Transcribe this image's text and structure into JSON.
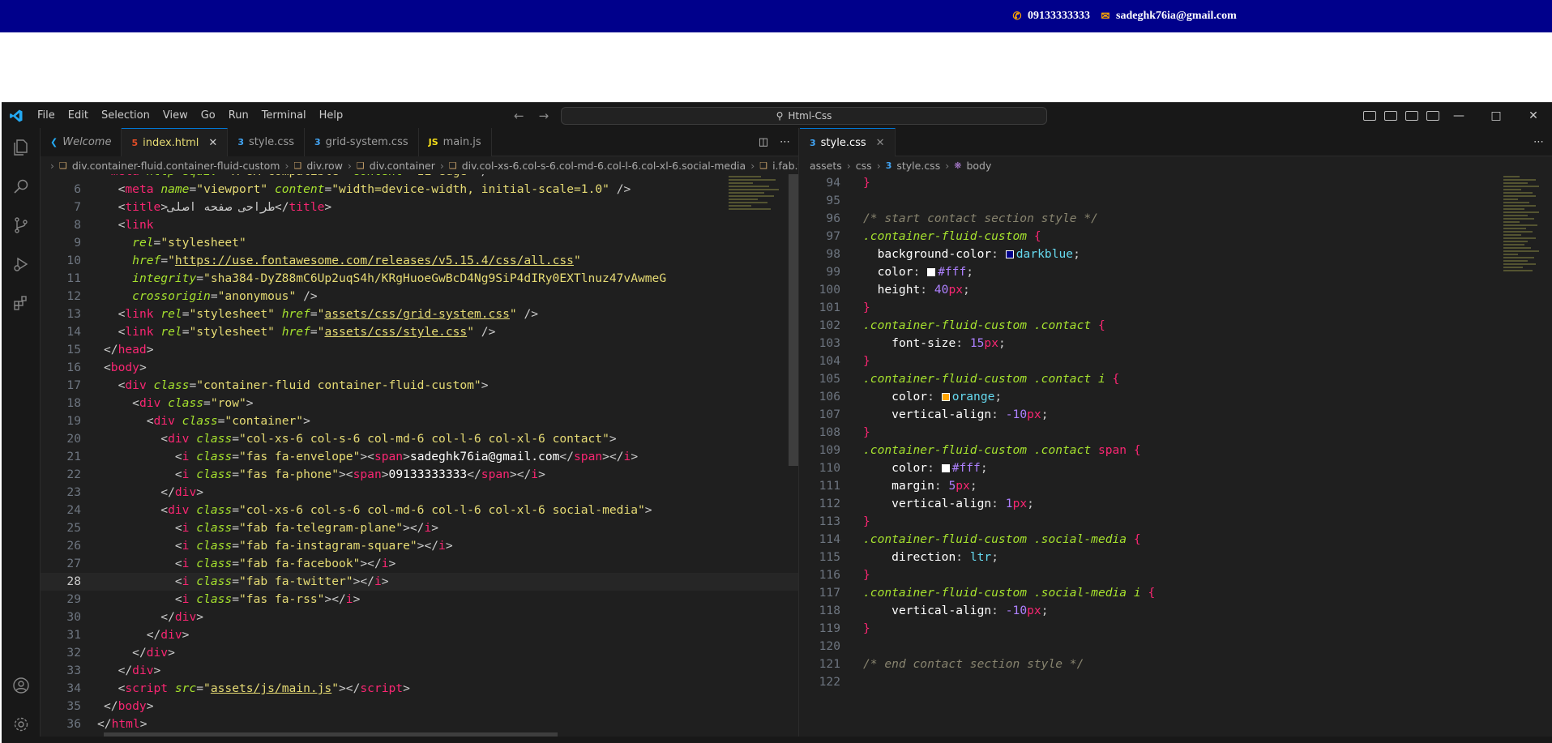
{
  "website": {
    "phone": "09133333333",
    "email": "sadeghk76ia@gmail.com",
    "icon_phone": "phone-icon",
    "icon_email": "envelope-icon",
    "bar_color": "#00008b",
    "icon_color": "#ffa500"
  },
  "titlebar": {
    "menu": [
      "File",
      "Edit",
      "Selection",
      "View",
      "Go",
      "Run",
      "Terminal",
      "Help"
    ],
    "search": "Html-Css"
  },
  "left_group": {
    "tabs": [
      {
        "label": "Welcome",
        "icon": "vscode-icon"
      },
      {
        "label": "index.html",
        "icon": "html5-icon",
        "active": true
      },
      {
        "label": "style.css",
        "icon": "css3-icon"
      },
      {
        "label": "grid-system.css",
        "icon": "css3-icon"
      },
      {
        "label": "main.js",
        "icon": "js-icon"
      }
    ],
    "breadcrumb": [
      "div.container-fluid.container-fluid-custom",
      "div.row",
      "div.container",
      "div.col-xs-6.col-s-6.col-md-6.col-l-6.col-xl-6.social-media",
      "i.fab.fa-twitter"
    ]
  },
  "right_group": {
    "tabs": [
      {
        "label": "style.css",
        "icon": "css3-icon",
        "active": true
      }
    ],
    "breadcrumb": [
      "assets",
      "css",
      "style.css",
      "body"
    ]
  },
  "accent": "#0078d4"
}
